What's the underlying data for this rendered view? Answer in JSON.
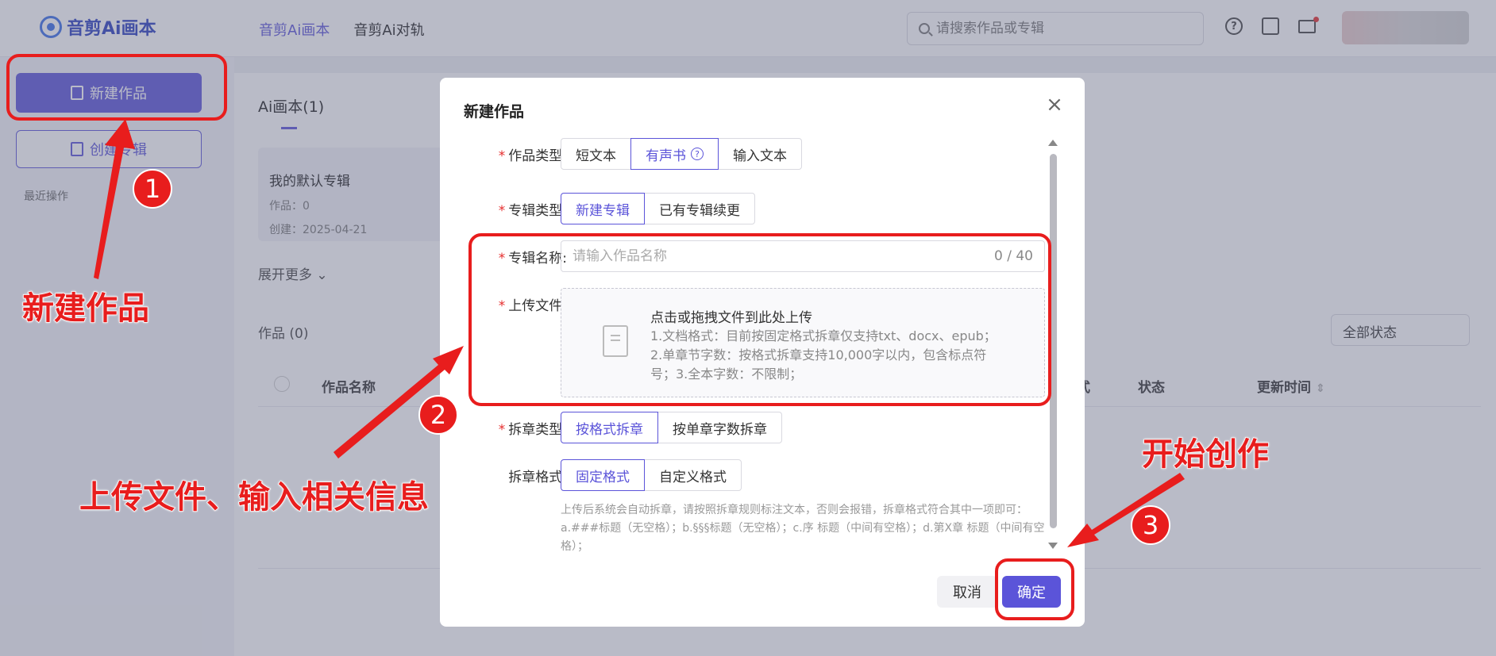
{
  "app": {
    "logo_text": "音剪Ai画本"
  },
  "nav": {
    "items": [
      "音剪Ai画本",
      "音剪Ai对轨"
    ],
    "active": 0
  },
  "search": {
    "placeholder": "请搜索作品或专辑"
  },
  "sidebar": {
    "new_work_label": "新建作品",
    "create_album_label": "创建专辑",
    "recent_label": "最近操作"
  },
  "main": {
    "tab_label": "Ai画本(1)",
    "album": {
      "title": "我的默认专辑",
      "works": "作品：0",
      "created": "创建：2025-04-21"
    },
    "expand_label": "展开更多",
    "works_title": "作品 (0)",
    "status_filter": "全部状态",
    "columns": [
      "作品名称",
      "式",
      "状态",
      "更新时间"
    ]
  },
  "modal": {
    "title": "新建作品",
    "work_type": {
      "label": "作品类型:",
      "options": [
        "短文本",
        "有声书",
        "输入文本"
      ],
      "selected": 1
    },
    "album_type": {
      "label": "专辑类型:",
      "options": [
        "新建专辑",
        "已有专辑续更"
      ],
      "selected": 0
    },
    "album_name": {
      "label": "专辑名称:",
      "placeholder": "请输入作品名称",
      "counter": "0 / 40"
    },
    "upload": {
      "label": "上传文件:",
      "title": "点击或拖拽文件到此处上传",
      "desc": "1.文档格式：目前按固定格式拆章仅支持txt、docx、epub；2.单章节字数：按格式拆章支持10,000字以内，包含标点符号；3.全本字数：不限制；"
    },
    "split_type": {
      "label": "拆章类型:",
      "options": [
        "按格式拆章",
        "按单章字数拆章"
      ],
      "selected": 0
    },
    "split_format": {
      "label": "拆章格式:",
      "options": [
        "固定格式",
        "自定义格式"
      ],
      "selected": 0
    },
    "hint": "上传后系统会自动拆章，请按照拆章规则标注文本，否则会报错，拆章格式符合其中一项即可：a.###标题（无空格）；b.§§§标题（无空格）；c.序 标题（中间有空格）；d.第X章 标题（中间有空格）；",
    "cancel_label": "取消",
    "ok_label": "确定"
  },
  "annotations": {
    "step1": "1",
    "step2": "2",
    "step3": "3",
    "text1": "新建作品",
    "text2": "上传文件、输入相关信息",
    "text3": "开始创作",
    "color": "#e81d1d"
  }
}
